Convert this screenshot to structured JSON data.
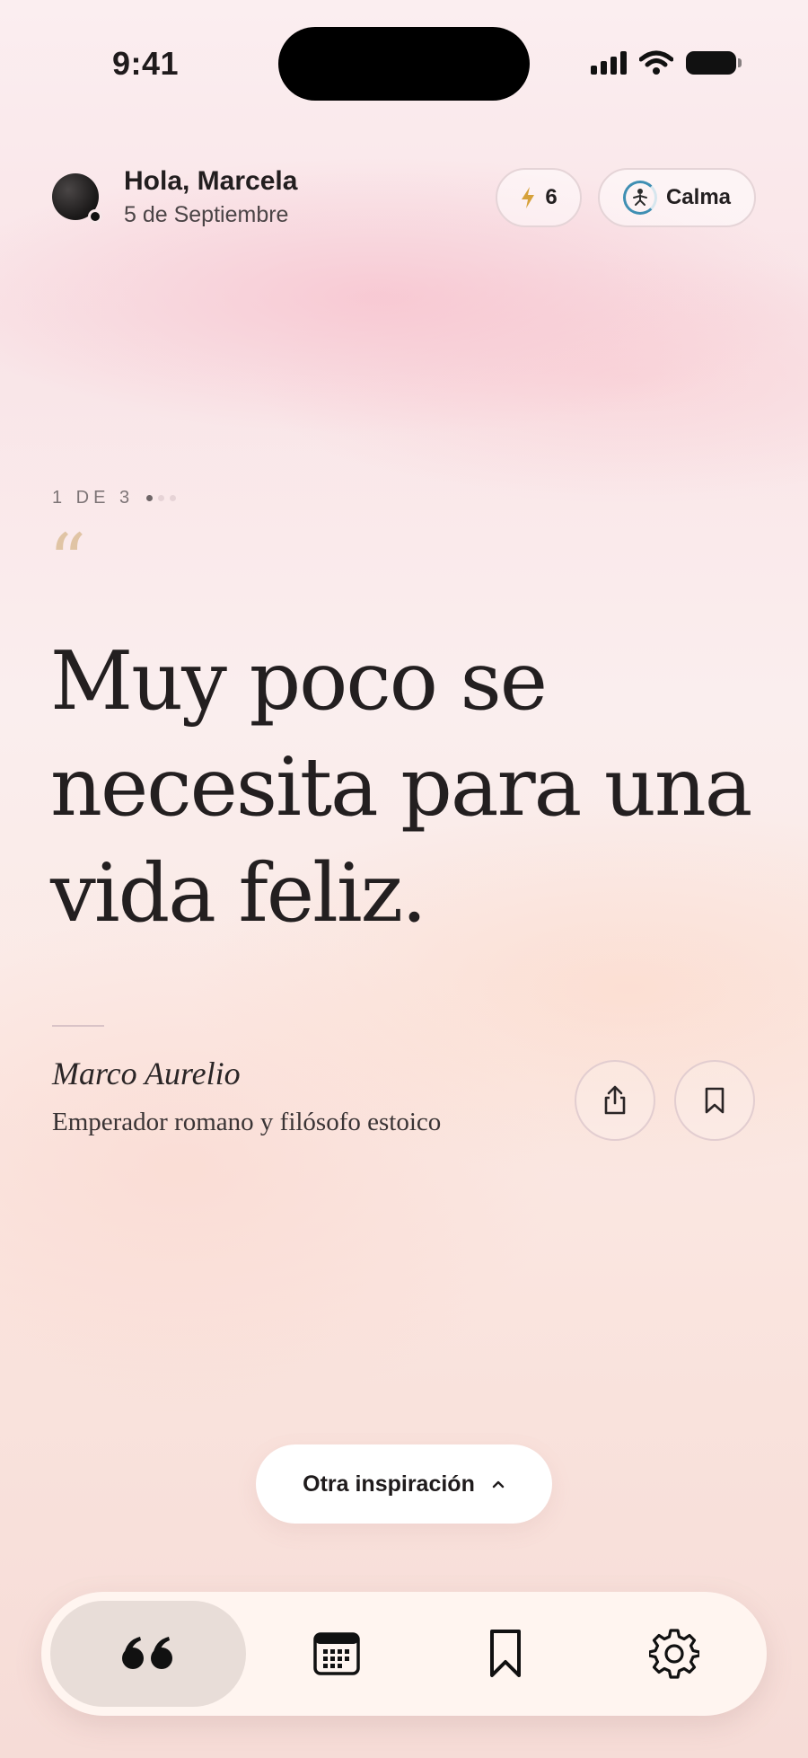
{
  "status_bar": {
    "time": "9:41"
  },
  "header": {
    "greeting": "Hola, Marcela",
    "date": "5 de Septiembre",
    "streak_count": "6",
    "mood_label": "Calma"
  },
  "quote": {
    "counter": "1 DE 3",
    "open_mark": "“",
    "text": "Muy poco se necesita para una vida feliz.",
    "author": "Marco Aurelio",
    "author_role": "Emperador romano y filósofo estoico"
  },
  "actions": {
    "another_label": "Otra inspiración"
  },
  "colors": {
    "accent_quote_mark": "#e0c4a4",
    "streak_bolt": "#d6a13a",
    "mood_ring": "#3f8fb3",
    "text_primary": "#231f20"
  },
  "tab_bar": {
    "tabs": [
      {
        "icon": "quote-icon",
        "active": true
      },
      {
        "icon": "calendar-icon",
        "active": false
      },
      {
        "icon": "bookmark-icon",
        "active": false
      },
      {
        "icon": "gear-icon",
        "active": false
      }
    ]
  }
}
